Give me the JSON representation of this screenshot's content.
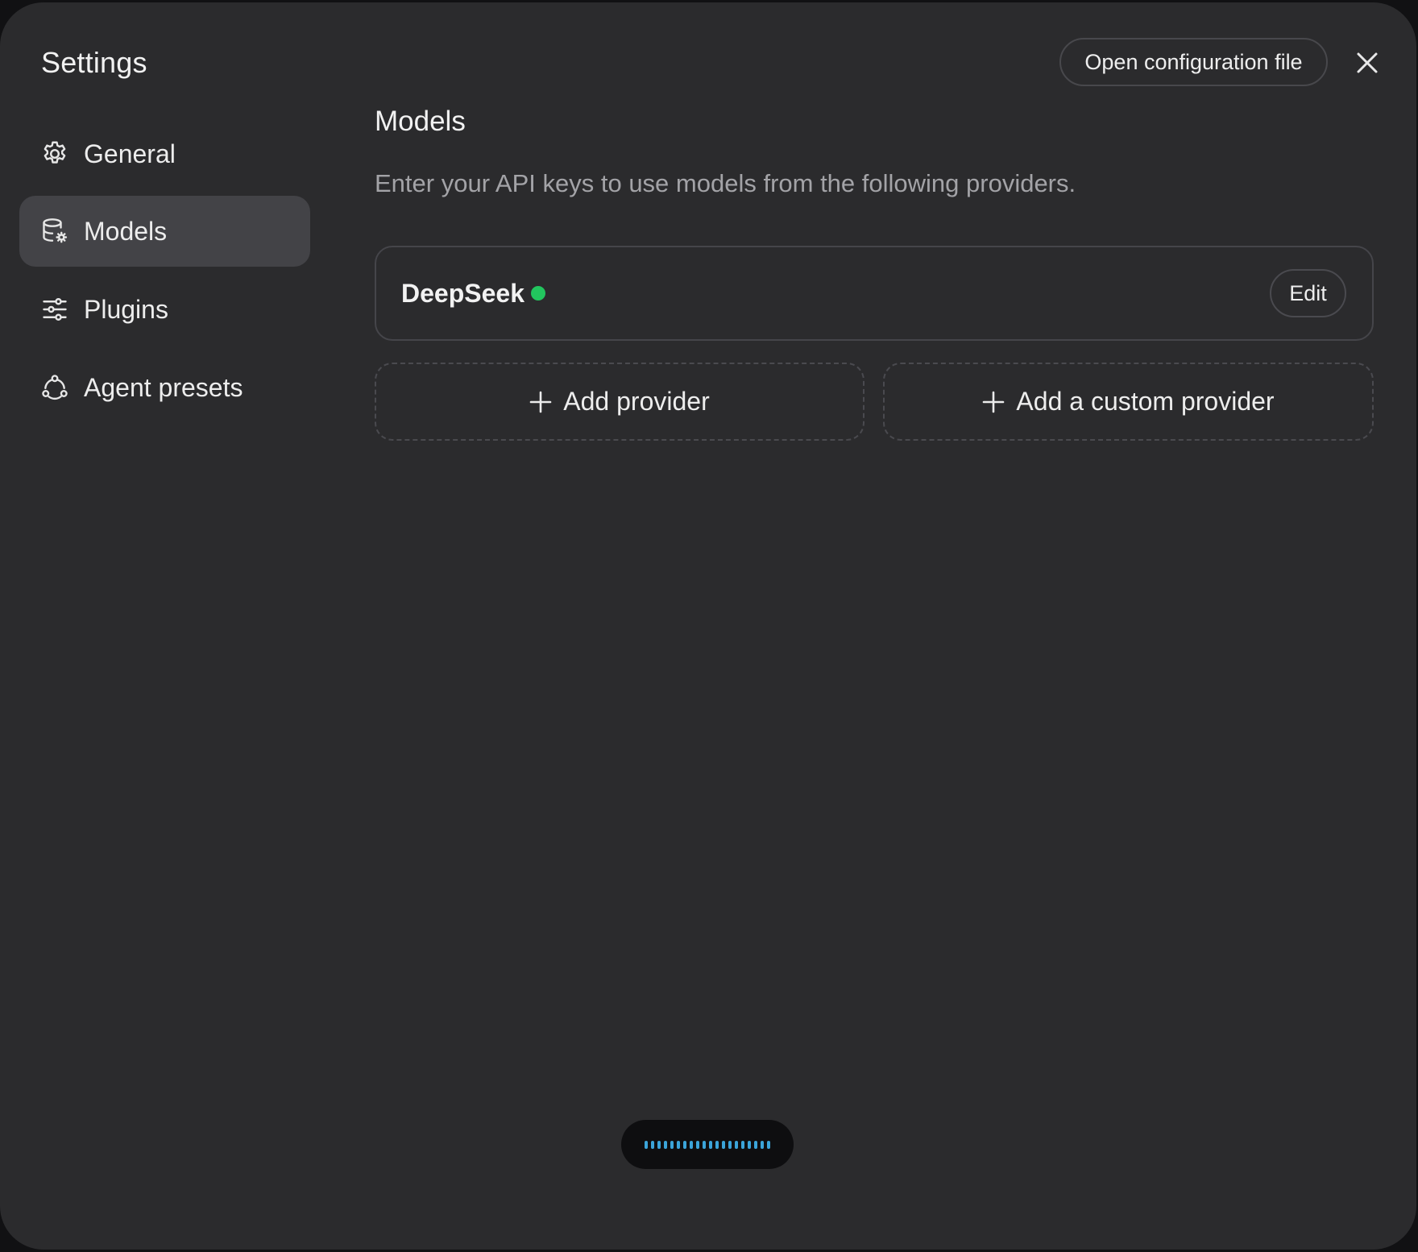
{
  "header": {
    "title": "Settings",
    "open_config_label": "Open configuration file",
    "close_icon": "close-icon"
  },
  "sidebar": {
    "items": [
      {
        "label": "General",
        "icon": "gear-icon",
        "active": false
      },
      {
        "label": "Models",
        "icon": "database-gear-icon",
        "active": true
      },
      {
        "label": "Plugins",
        "icon": "sliders-icon",
        "active": false
      },
      {
        "label": "Agent presets",
        "icon": "agent-nodes-icon",
        "active": false
      }
    ]
  },
  "main": {
    "section_title": "Models",
    "description": "Enter your API keys to use models from the following providers.",
    "providers": [
      {
        "name": "DeepSeek",
        "status_color": "#22c55e",
        "edit_label": "Edit"
      }
    ],
    "add_provider_label": "Add provider",
    "add_custom_provider_label": "Add a custom provider"
  },
  "recorder": {
    "icon": "audio-waveform-icon",
    "bar_color": "#3ba4d9"
  },
  "colors": {
    "window_bg": "#2b2b2d",
    "active_item_bg": "#434347",
    "accent_green": "#22c55e"
  }
}
